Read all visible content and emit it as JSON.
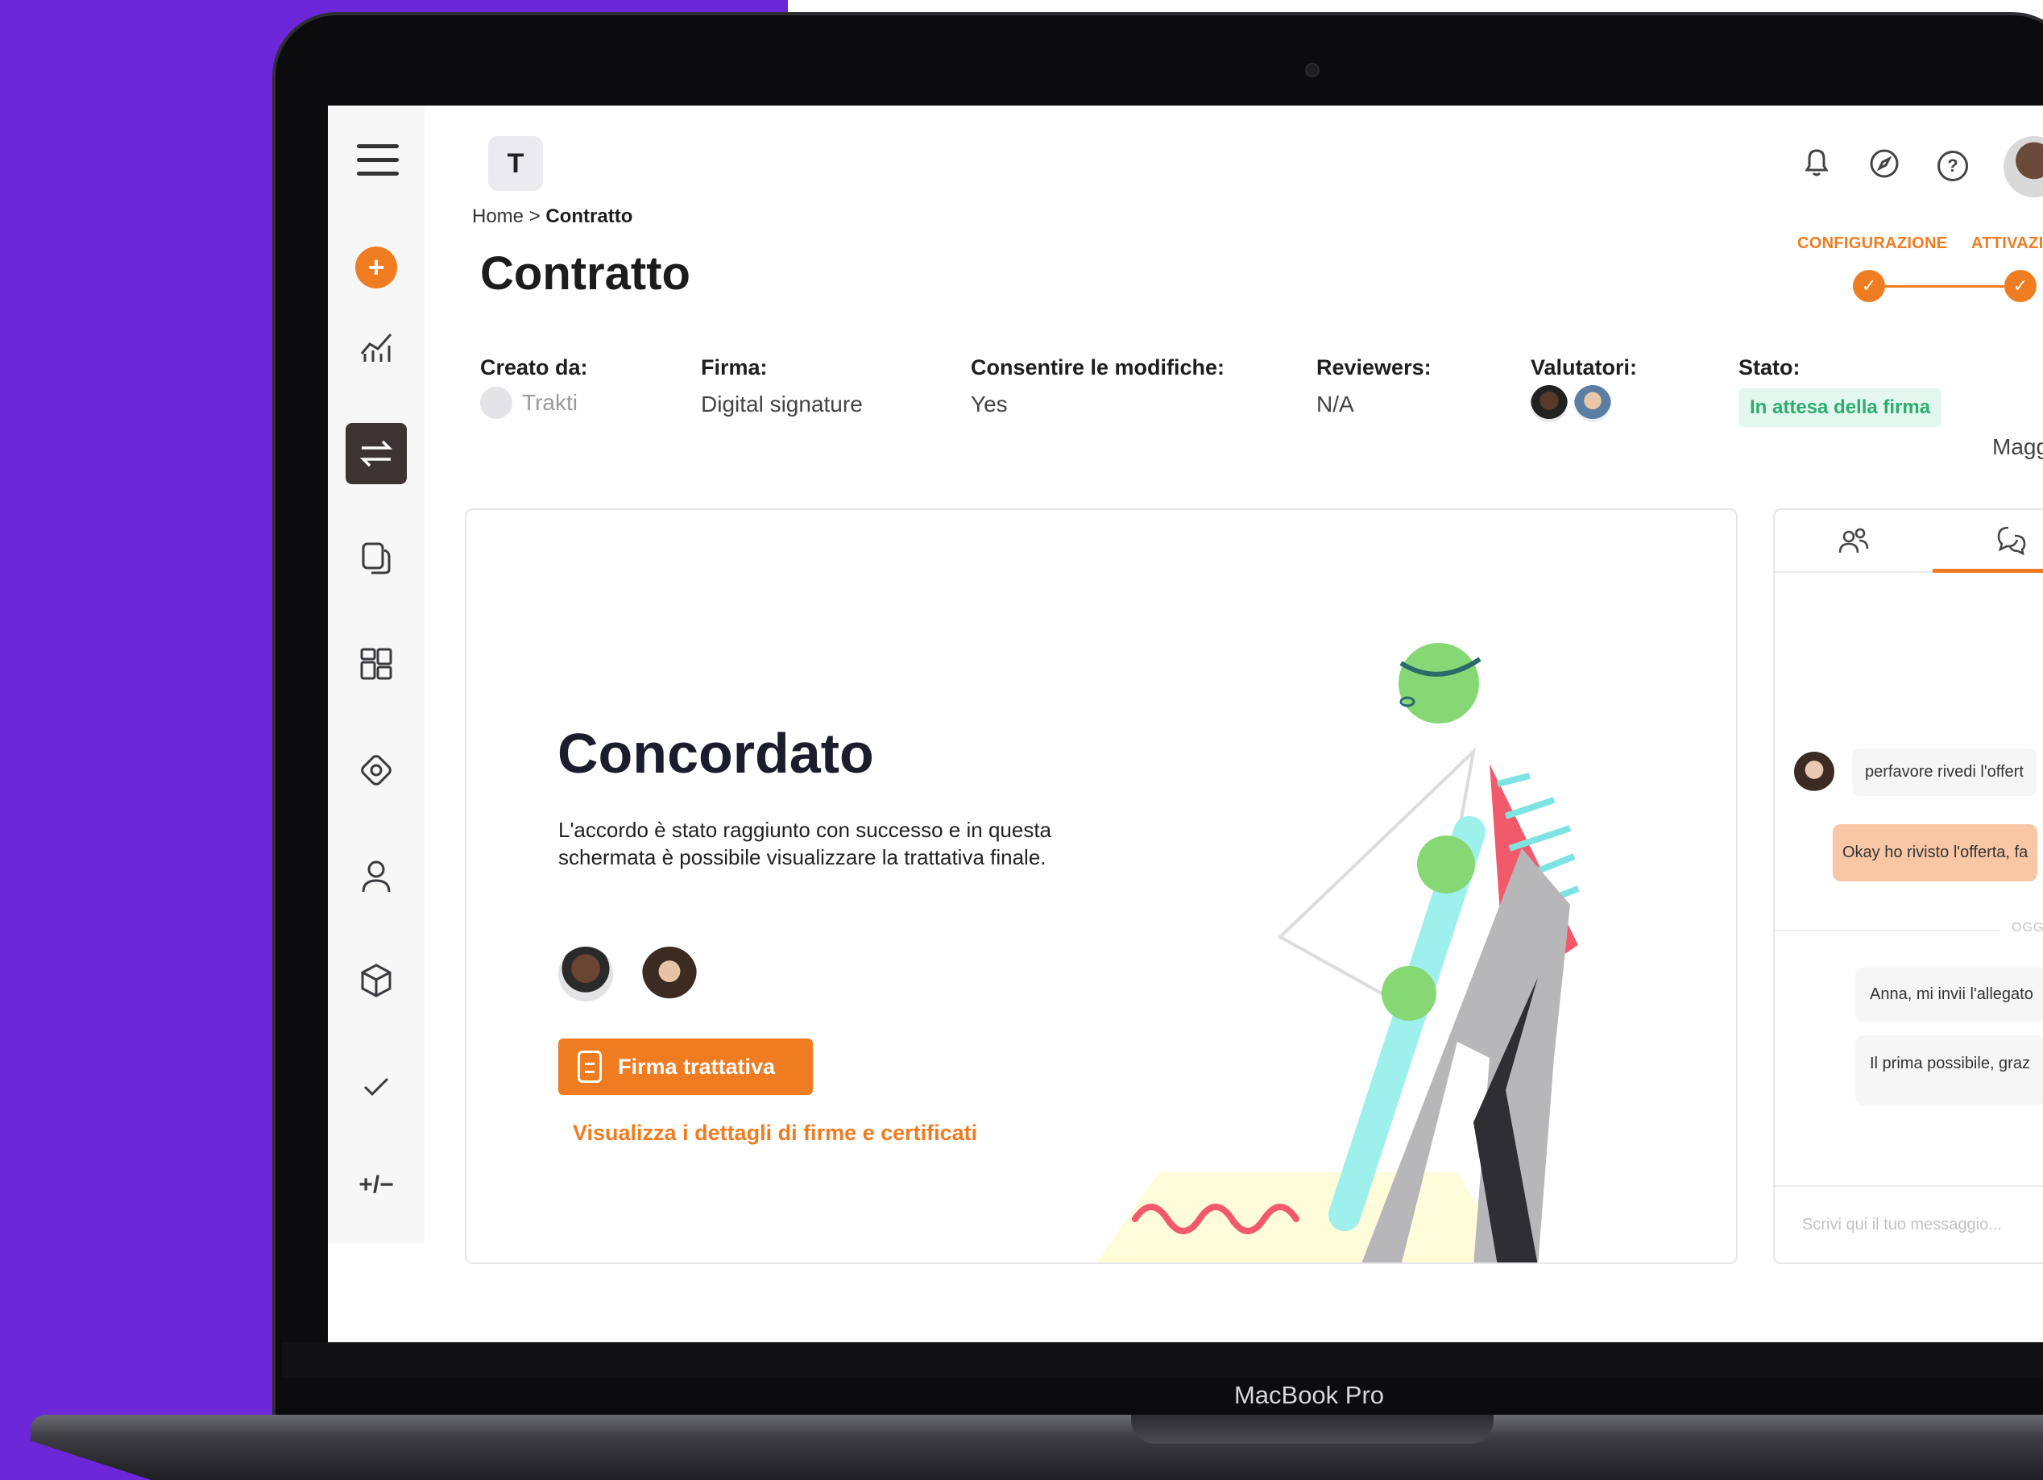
{
  "device": {
    "label": "MacBook Pro"
  },
  "app": {
    "logo_letter": "T"
  },
  "breadcrumb": {
    "home": "Home",
    "separator": ">",
    "current": "Contratto"
  },
  "page": {
    "title": "Contratto"
  },
  "stepper": {
    "steps": [
      {
        "label": "CONFIGURAZIONE",
        "done": true
      },
      {
        "label": "ATTIVAZIO",
        "done": true
      }
    ]
  },
  "meta": {
    "created_by_label": "Creato da:",
    "created_by_value": "Trakti",
    "signature_label": "Firma:",
    "signature_value": "Digital signature",
    "allow_edits_label": "Consentire le modifiche:",
    "allow_edits_value": "Yes",
    "reviewers_label": "Reviewers:",
    "reviewers_value": "N/A",
    "evaluators_label": "Valutatori:",
    "status_label": "Stato:",
    "status_value": "In attesa della firma",
    "more_label": "Magg"
  },
  "card": {
    "title": "Concordato",
    "description": "L'accordo è stato raggiunto con successo e in questa schermata è possibile visualizzare la trattativa finale.",
    "sign_button": "Firma trattativa",
    "details_link": "Visualizza i dettagli di firme e certificati"
  },
  "chat": {
    "messages": [
      {
        "text": "perfavore rivedi l'offert",
        "direction": "in"
      },
      {
        "text": "Okay ho rivisto l'offerta, fa",
        "direction": "out"
      },
      {
        "text": "Anna, mi invii l'allegato",
        "direction": "in"
      },
      {
        "text": "Il prima possibile, graz",
        "direction": "in"
      }
    ],
    "divider_label": "OGGI",
    "input_placeholder": "Scrivi qui il tuo messaggio..."
  },
  "icons": {
    "sidebar": [
      "hamburger-icon",
      "plus-icon",
      "analytics-icon",
      "swap-icon",
      "documents-icon",
      "dashboard-icon",
      "support-icon",
      "user-icon",
      "package-icon",
      "check-icon",
      "plus-minus-icon"
    ],
    "topbar": [
      "bell-icon",
      "compass-icon",
      "help-icon"
    ]
  },
  "colors": {
    "accent": "#f07c22",
    "background_left": "#6c27d9",
    "status_green": "#2aae72",
    "status_green_bg": "#e4f7ee",
    "chat_out_bubble": "#f8c7a5"
  }
}
